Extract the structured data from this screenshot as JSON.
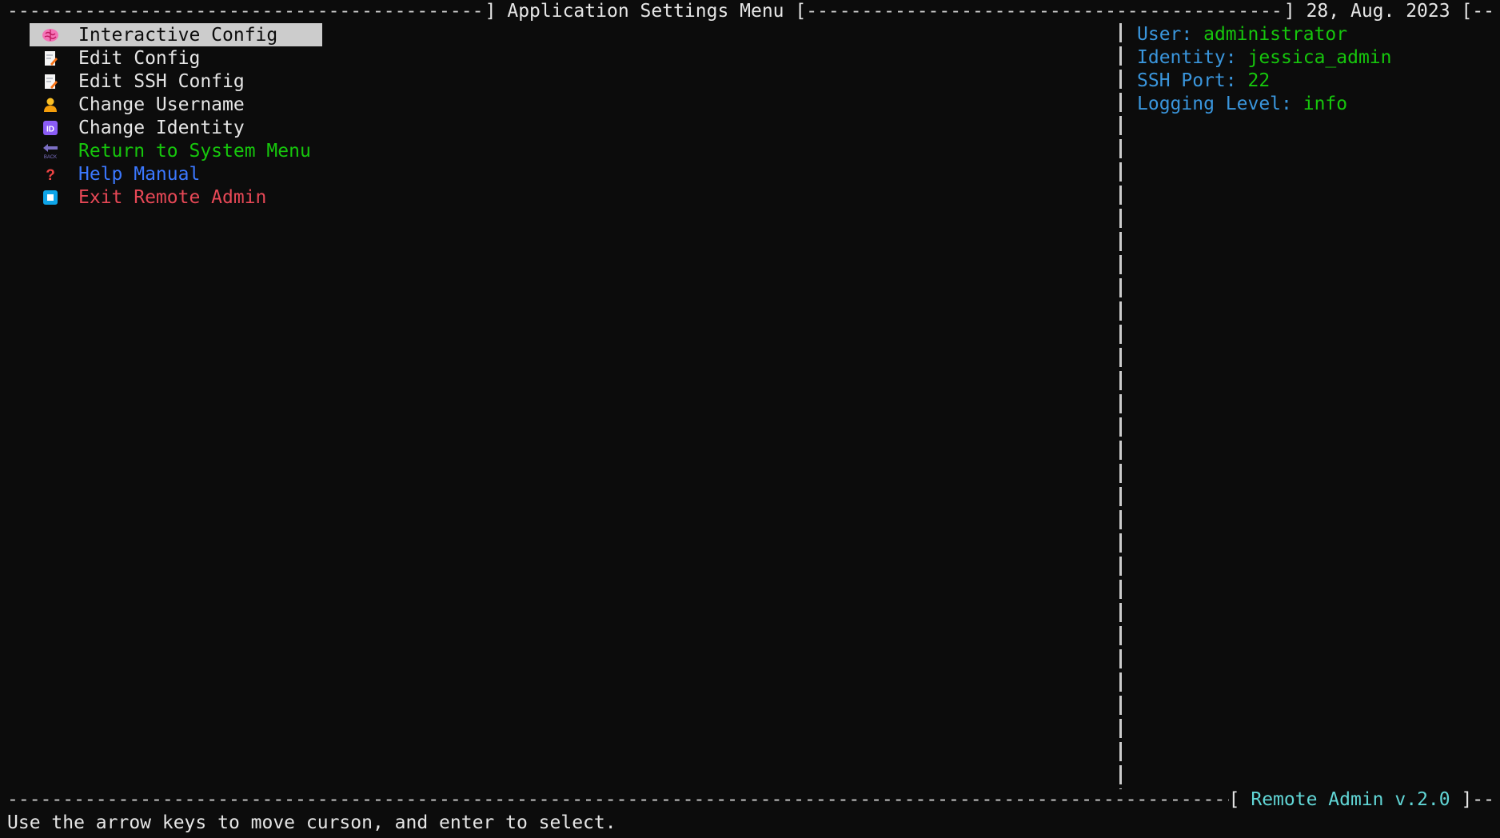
{
  "header": {
    "title": "] Application Settings Menu [",
    "date": "] 28, Aug. 2023 [--"
  },
  "menu": {
    "items": [
      {
        "label": "Interactive Config",
        "icon": "brain-icon",
        "selected": true
      },
      {
        "label": "Edit Config",
        "icon": "memo-icon",
        "selected": false
      },
      {
        "label": "Edit SSH Config",
        "icon": "memo-icon",
        "selected": false
      },
      {
        "label": "Change Username",
        "icon": "person-icon",
        "selected": false
      },
      {
        "label": "Change Identity",
        "icon": "id-icon",
        "selected": false
      },
      {
        "label": "Return to System Menu",
        "icon": "back-arrow-icon",
        "selected": false
      },
      {
        "label": "Help Manual",
        "icon": "question-mark-icon",
        "selected": false
      },
      {
        "label": "Exit Remote Admin",
        "icon": "stop-square-icon",
        "selected": false
      }
    ]
  },
  "info": {
    "user_label": "User: ",
    "user_value": "administrator",
    "identity_label": "Identity: ",
    "identity_value": "jessica_admin",
    "ssh_port_label": "SSH Port: ",
    "ssh_port_value": "22",
    "logging_label": "Logging Level: ",
    "logging_value": "info"
  },
  "footer": {
    "version_open": "[ ",
    "version": "Remote Admin v.2.0",
    "version_close": " ]--",
    "status": "Use the arrow keys to move curson, and enter to select."
  },
  "colors": {
    "background": "#0c0c0c",
    "selection": "#cccccc",
    "green": "#16c60c",
    "blue": "#3b78ff",
    "red": "#e74856",
    "cyan": "#61d6d6",
    "label_blue": "#3a96dd"
  }
}
